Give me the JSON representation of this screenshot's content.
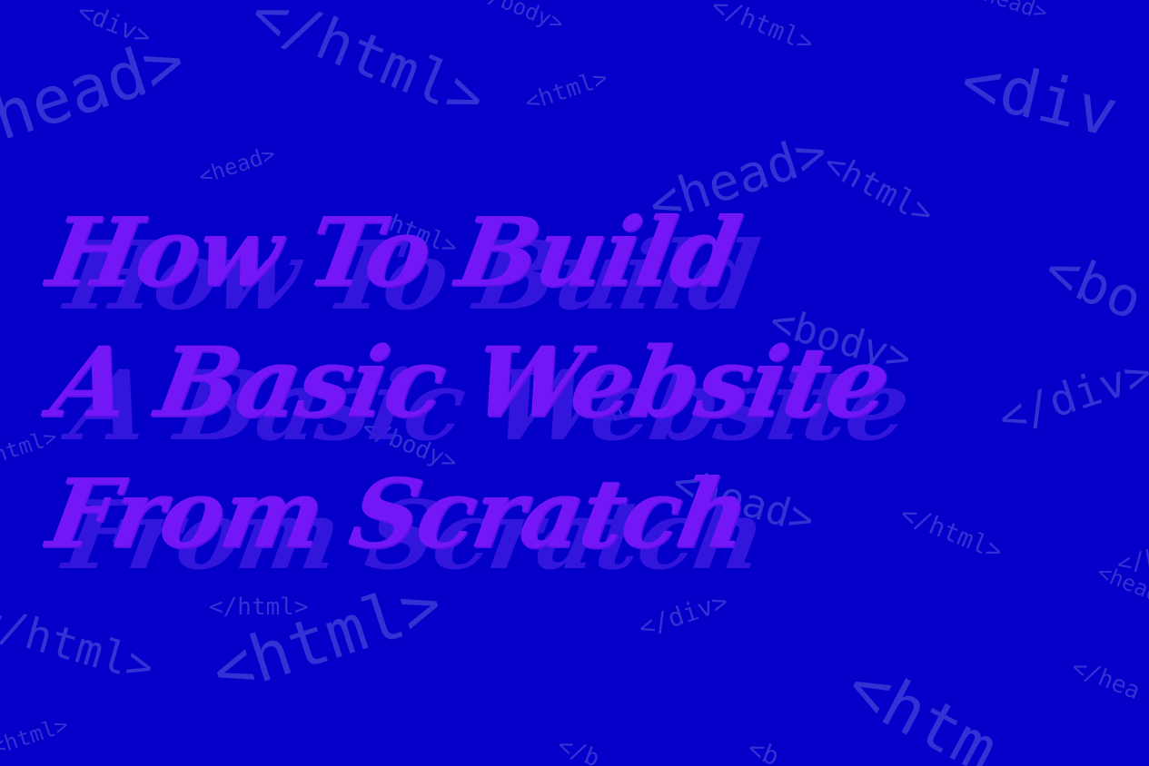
{
  "colors": {
    "background": "#0500c9",
    "tag_text": "#3e42d8",
    "title": "#7417f6",
    "title_shadow": "#3819df"
  },
  "title": {
    "line1": "How To Build",
    "line2": "A Basic Website",
    "line3": "From Scratch"
  },
  "background_tags": [
    "<div>",
    "</html>",
    "</body>",
    "</html>",
    "</head>",
    "<div",
    "<head>",
    "<html>",
    "<head>",
    "<html>",
    "<bo",
    "<body>",
    "<head>",
    "</body>",
    "</div>",
    "</html>",
    "<h",
    "</html>",
    "</div>",
    "<html>",
    "</hea",
    "<htm",
    "</html>",
    "<html>",
    "<head>",
    "</html>",
    "</b",
    "<b",
    "</head",
    "<html>",
    "<head>"
  ]
}
